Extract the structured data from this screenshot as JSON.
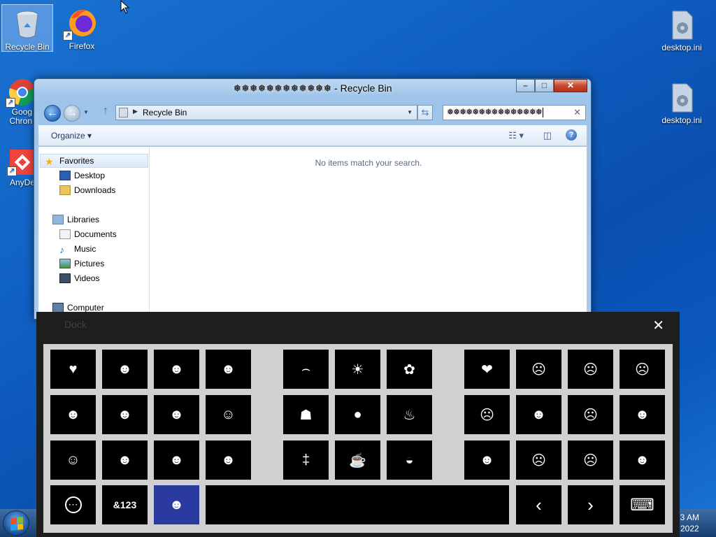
{
  "desktop": {
    "icons_left": [
      {
        "label": "Recycle Bin"
      },
      {
        "label": "Firefox"
      },
      {
        "label": "Goog Chron"
      },
      {
        "label": "AnyDe"
      }
    ],
    "icons_right": [
      {
        "label": "desktop.ini"
      },
      {
        "label": "desktop.ini"
      }
    ]
  },
  "explorer": {
    "title": "❅❅❅❅❅❅❅❅❅❅❅❅ - Recycle Bin",
    "address": "Recycle Bin",
    "search_value": "❅❅❅❅❅❅❅❅❅❅❅❅❅❅❅",
    "organize_label": "Organize",
    "empty_message": "No items match your search.",
    "nav": {
      "favorites": "Favorites",
      "desktop": "Desktop",
      "downloads": "Downloads",
      "libraries": "Libraries",
      "documents": "Documents",
      "music": "Music",
      "pictures": "Pictures",
      "videos": "Videos",
      "computer": "Computer"
    }
  },
  "keyboard": {
    "title": "Dock",
    "close_glyph": "✕",
    "keys": [
      [
        "♥",
        "☻",
        "☻",
        "☻",
        "⌢",
        "☀",
        "✿",
        "❤",
        "☹",
        "☹",
        "☹"
      ],
      [
        "☻",
        "☻",
        "☻",
        "☺",
        "☗",
        "●",
        "♨",
        "☹",
        "☻",
        "☹",
        "☻"
      ],
      [
        "☺",
        "☻",
        "☻",
        "☻",
        "‡",
        "☕",
        "◒",
        "☻",
        "☹",
        "☹",
        "☻"
      ]
    ],
    "bottom": {
      "more_glyph": "⋯",
      "symbols_label": "&123",
      "emoji_glyph": "☻",
      "prev_glyph": "‹",
      "next_glyph": "›",
      "keyboard_glyph": "⌨"
    }
  },
  "taskbar": {
    "time": "3 AM",
    "date": "2022"
  }
}
